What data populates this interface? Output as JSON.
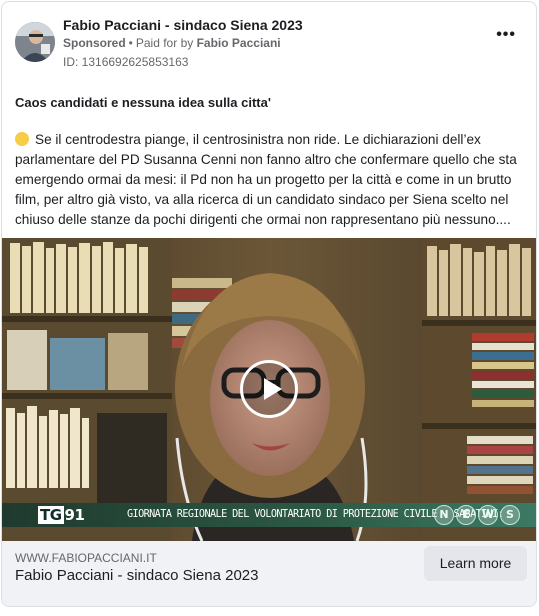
{
  "header": {
    "page_name": "Fabio Pacciani - sindaco Siena 2023",
    "sponsored_label": "Sponsored",
    "separator": "•",
    "paid_for_label": "Paid for by",
    "paid_for_name": "Fabio Pacciani",
    "ad_id_label": "ID: 1316692625853163",
    "more_label": "•••"
  },
  "post": {
    "headline": "Caos candidati e nessuna idea sulla citta'",
    "body": "Se il centrodestra piange, il centrosinistra non ride. Le dichiarazioni dell’ex parlamentare del PD Susanna Cenni non fanno altro che confermare quello che sta emergendo ormai da mesi: il Pd non ha un progetto per la città e come in un brutto film, per altro già visto, va alla ricerca di un candidato sindaco per Siena scelto nel chiuso delle stanze da pochi dirigenti che ormai non rappresentano più nessuno...."
  },
  "video": {
    "channel_logo_box": "TG",
    "channel_logo_num": "91",
    "ticker_text": "GIORNATA REGIONALE DEL VOLONTARIATO DI PROTEZIONE CIVILE  -  SABATINI:",
    "news_letters": [
      "N",
      "E",
      "W",
      "S"
    ]
  },
  "footer": {
    "domain": "WWW.FABIOPACCIANI.IT",
    "title": "Fabio Pacciani - sindaco Siena 2023",
    "cta_label": "Learn more"
  }
}
